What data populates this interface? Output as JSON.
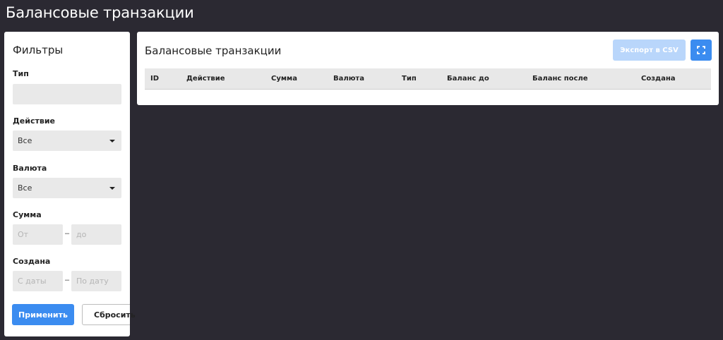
{
  "page": {
    "title": "Балансовые транзакции"
  },
  "filters": {
    "title": "Фильтры",
    "type": {
      "label": "Тип",
      "value": ""
    },
    "action": {
      "label": "Действие",
      "value": "Все"
    },
    "currency": {
      "label": "Валюта",
      "value": "Все"
    },
    "amount": {
      "label": "Сумма",
      "from_placeholder": "От",
      "to_placeholder": "до",
      "separator": "–"
    },
    "created": {
      "label": "Создана",
      "from_placeholder": "С даты",
      "to_placeholder": "По дату",
      "separator": "–"
    },
    "apply_label": "Применить",
    "reset_label": "Сбросить"
  },
  "main": {
    "title": "Балансовые транзакции",
    "export_label": "Экспорт в CSV",
    "fullscreen_icon": "fullscreen-icon",
    "columns": [
      "ID",
      "Действие",
      "Сумма",
      "Валюта",
      "Тип",
      "Баланс до",
      "Баланс после",
      "Создана"
    ]
  },
  "colors": {
    "background": "#2b2932",
    "primary": "#3b8cf0",
    "primary_disabled": "#b9d6fb"
  }
}
